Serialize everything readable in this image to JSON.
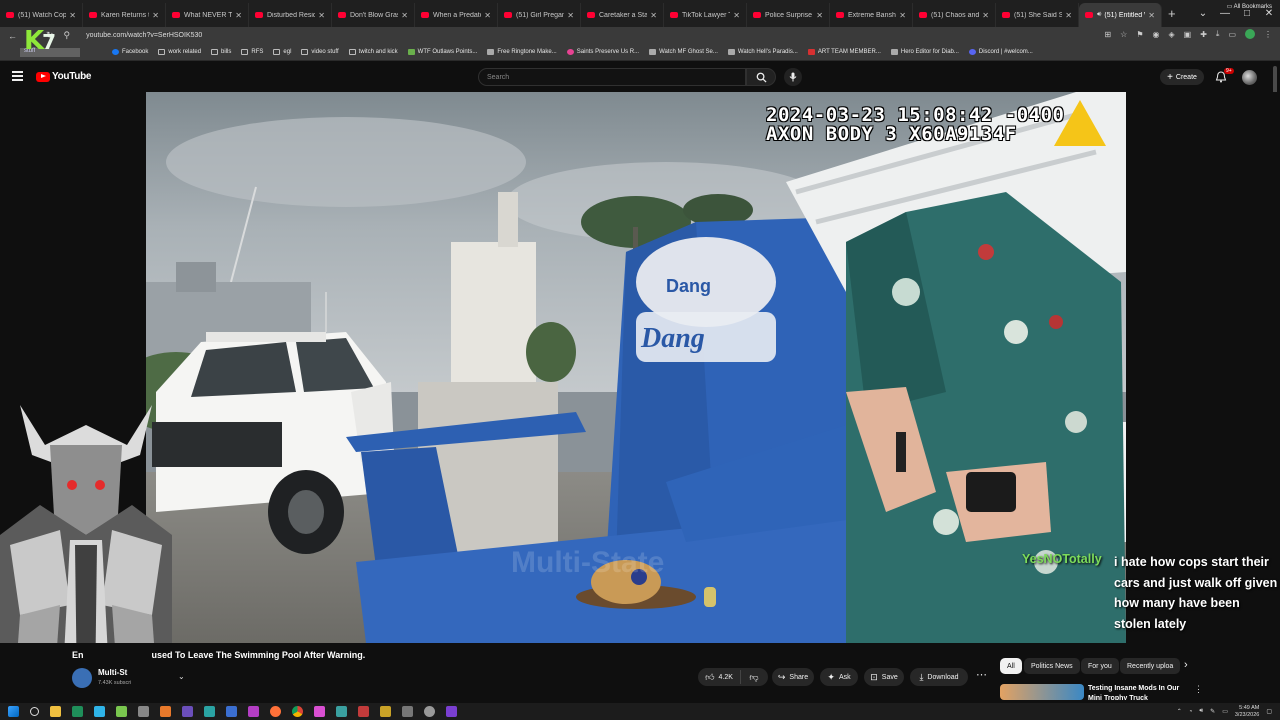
{
  "browser": {
    "tabs": [
      {
        "title": "(51) Watch Cop C",
        "active": false
      },
      {
        "title": "Karen Returns to",
        "active": false
      },
      {
        "title": "What NEVER To D",
        "active": false
      },
      {
        "title": "Disturbed Reside",
        "active": false
      },
      {
        "title": "Don't Blow Grass",
        "active": false
      },
      {
        "title": "When a Predator",
        "active": false
      },
      {
        "title": "(51) Girl Pregame",
        "active": false
      },
      {
        "title": "Caretaker a Stan",
        "active": false
      },
      {
        "title": "TikTok Lawyer Tri",
        "active": false
      },
      {
        "title": "Police Surprise Tr",
        "active": false
      },
      {
        "title": "Extreme Banshee",
        "active": false
      },
      {
        "title": "(51) Chaos and K",
        "active": false
      },
      {
        "title": "(51) She Said She",
        "active": false
      },
      {
        "title": "(51) Entitled W",
        "active": true
      }
    ],
    "new_tab": "+",
    "url": "youtube.com/watch?v=SerHSOIK530",
    "bookmarks": [
      {
        "label": "Facebook",
        "icon": "facebook-icon"
      },
      {
        "label": "work related",
        "icon": "folder-icon"
      },
      {
        "label": "bills",
        "icon": "folder-icon"
      },
      {
        "label": "RFS",
        "icon": "folder-icon"
      },
      {
        "label": "egl",
        "icon": "folder-icon"
      },
      {
        "label": "video stuff",
        "icon": "folder-icon"
      },
      {
        "label": "twitch and kick",
        "icon": "folder-icon"
      },
      {
        "label": "WTF Outlaws Points...",
        "icon": "app-icon"
      },
      {
        "label": "Free Ringtone Make...",
        "icon": "page-icon"
      },
      {
        "label": "Saints Preserve Us R...",
        "icon": "pink-icon"
      },
      {
        "label": "Watch MF Ghost Se...",
        "icon": "grey-icon"
      },
      {
        "label": "Watch Hell's Paradis...",
        "icon": "grey-icon"
      },
      {
        "label": "ART TEAM MEMBER...",
        "icon": "red-icon"
      },
      {
        "label": "Hero Editor for Diab...",
        "icon": "page-icon"
      },
      {
        "label": "Discord | #welcom...",
        "icon": "discord-icon"
      }
    ],
    "all_bookmarks": "All Bookmarks",
    "bookmark_folder_label": "stuff",
    "profile_color": "#3aa757"
  },
  "overlay": {
    "logo_k": "K",
    "logo_7": "7"
  },
  "youtube": {
    "logo_text": "YouTube",
    "search_placeholder": "Search",
    "create_label": "Create",
    "notification_badge": "9+",
    "brand_color": "#ff0000"
  },
  "video": {
    "timestamp": "2024-03-23 15:08:42 -0400",
    "device": "AXON BODY 3 X60A9134F",
    "title": "Entitled ... Refused To Leave The Swimming Pool After Warning.",
    "title_visible": "En",
    "title_visible_2": "used To Leave The Swimming Pool After Warning."
  },
  "chat": {
    "username": "YesNOTotally",
    "message": "i hate how cops start their cars and just walk off given how many have been stolen lately",
    "username_color": "#7ddc5a"
  },
  "channel": {
    "name": "Multi-St",
    "subscribers": "7.43K subscri"
  },
  "actions": {
    "likes": "4.2K",
    "share": "Share",
    "ask": "Ask",
    "save": "Save",
    "download": "Download"
  },
  "chips": [
    {
      "label": "All",
      "active": true
    },
    {
      "label": "Politics News",
      "active": false
    },
    {
      "label": "For you",
      "active": false
    },
    {
      "label": "Recently uploa",
      "active": false
    }
  ],
  "recommended": {
    "title": "Testing Insane Mods In Our Mini Trophy Truck"
  },
  "taskbar": {
    "time": "5:49 AM",
    "date": "3/23/2026"
  }
}
